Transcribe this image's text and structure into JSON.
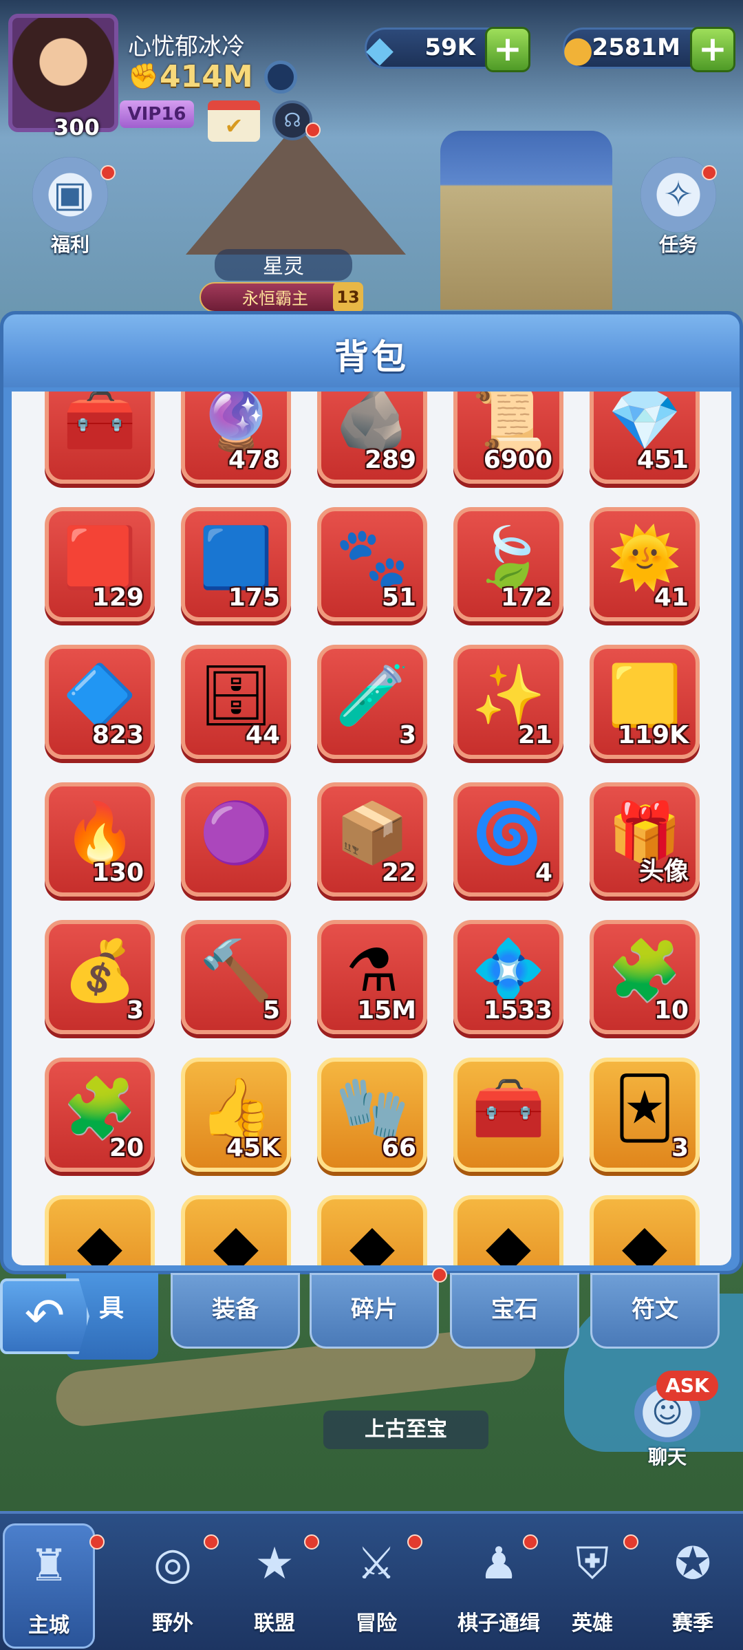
{
  "player": {
    "name": "心忧郁冰冷",
    "level": "300",
    "power": "414M",
    "vip": "VIP16"
  },
  "currencies": [
    {
      "icon": "diamond-icon",
      "value": "59K"
    },
    {
      "icon": "gold-coin-icon",
      "value": "2581M"
    }
  ],
  "side_buttons": {
    "welfare": "福利",
    "quests": "任务"
  },
  "scene": {
    "banner_name": "星灵",
    "title_badge": "永恒霸主",
    "title_level": "13",
    "location": "上古至宝"
  },
  "backpack": {
    "title": "背包",
    "items": [
      {
        "icon": "golden-chest-icon",
        "qty": "",
        "style": "red"
      },
      {
        "icon": "crystal-orb-icon",
        "qty": "478",
        "style": "red"
      },
      {
        "icon": "rune-stone-icon",
        "qty": "289",
        "style": "red"
      },
      {
        "icon": "flame-scroll-icon",
        "qty": "6900",
        "style": "red"
      },
      {
        "icon": "blue-crystal-icon",
        "qty": "451",
        "style": "red"
      },
      {
        "icon": "red-rune-card-icon",
        "qty": "129",
        "style": "red"
      },
      {
        "icon": "blue-tower-card-icon",
        "qty": "175",
        "style": "red"
      },
      {
        "icon": "paw-card-icon",
        "qty": "51",
        "style": "red"
      },
      {
        "icon": "leaf-card-icon",
        "qty": "172",
        "style": "red"
      },
      {
        "icon": "sun-card-icon",
        "qty": "41",
        "style": "red"
      },
      {
        "icon": "blue-gem-icon",
        "qty": "823",
        "style": "red"
      },
      {
        "icon": "silver-chest-icon",
        "qty": "44",
        "style": "red"
      },
      {
        "icon": "purple-potion-icon",
        "qty": "3",
        "style": "red"
      },
      {
        "icon": "winged-gem-icon",
        "qty": "21",
        "style": "red"
      },
      {
        "icon": "gold-ore-icon",
        "qty": "119K",
        "style": "red"
      },
      {
        "icon": "fire-crystal-icon",
        "qty": "130",
        "style": "red"
      },
      {
        "icon": "purple-coin-icon",
        "qty": "",
        "style": "red"
      },
      {
        "icon": "wooden-chest-icon",
        "qty": "22",
        "style": "red"
      },
      {
        "icon": "hero-scroll-5-star-icon",
        "qty": "4",
        "style": "red"
      },
      {
        "icon": "avatar-chest-icon",
        "qty": "头像",
        "style": "red"
      },
      {
        "icon": "treasure-chest-icon",
        "qty": "3",
        "style": "red"
      },
      {
        "icon": "golden-hammer-icon",
        "qty": "5",
        "style": "red"
      },
      {
        "icon": "blue-potion-icon",
        "qty": "15M",
        "style": "red"
      },
      {
        "icon": "prism-crystal-icon",
        "qty": "1533",
        "style": "red"
      },
      {
        "icon": "puzzle-fragment-icon",
        "qty": "10",
        "style": "red"
      },
      {
        "icon": "puzzle-fragment-icon",
        "qty": "20",
        "style": "red"
      },
      {
        "icon": "thumbs-up-medal-icon",
        "qty": "45K",
        "style": "gold"
      },
      {
        "icon": "dark-gauntlet-icon",
        "qty": "66",
        "style": "gold"
      },
      {
        "icon": "golden-chest-icon",
        "qty": "",
        "style": "gold"
      },
      {
        "icon": "hero-card-icon",
        "qty": "3",
        "style": "gold"
      },
      {
        "icon": "partial-item-icon",
        "qty": "",
        "style": "gold"
      },
      {
        "icon": "partial-item-icon",
        "qty": "",
        "style": "gold"
      },
      {
        "icon": "partial-item-icon",
        "qty": "",
        "style": "gold"
      },
      {
        "icon": "partial-item-icon",
        "qty": "",
        "style": "gold"
      },
      {
        "icon": "partial-item-icon",
        "qty": "",
        "style": "gold"
      }
    ]
  },
  "tabs": {
    "items_fragment": "具",
    "equipment": "装备",
    "fragments": "碎片",
    "gems": "宝石",
    "runes": "符文"
  },
  "chat": {
    "label": "聊天",
    "badge": "ASK"
  },
  "bottom_nav": [
    {
      "icon": "castle-icon",
      "label": "主城"
    },
    {
      "icon": "portal-icon",
      "label": "野外"
    },
    {
      "icon": "shield-star-icon",
      "label": "联盟"
    },
    {
      "icon": "sword-icon",
      "label": "冒险"
    },
    {
      "icon": "chess-piece-icon",
      "label": "棋子通缉"
    },
    {
      "icon": "helmet-icon",
      "label": "英雄"
    },
    {
      "icon": "star-badge-icon",
      "label": "赛季"
    }
  ],
  "colors": {
    "panel_blue": "#4f8dd6",
    "cell_red": "#d8413c",
    "cell_gold": "#eea030",
    "plus_green": "#6fbf3a"
  }
}
